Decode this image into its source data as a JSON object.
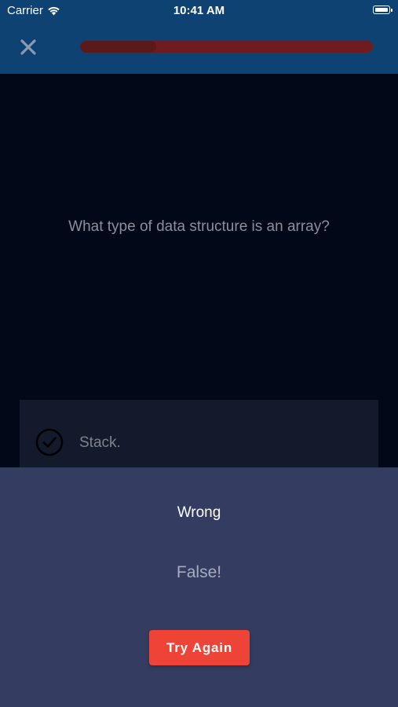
{
  "status_bar": {
    "carrier": "Carrier",
    "time": "10:41 AM",
    "icons": [
      "wifi-icon",
      "battery-icon"
    ]
  },
  "header": {
    "close_icon": "close-icon",
    "progress": 0.26,
    "colors": {
      "background": "#0e4273",
      "progress_track": "#6e1c1f",
      "progress_fill": "#5a1a1a"
    }
  },
  "question": {
    "text": "What type of data structure is an array?"
  },
  "answers": [
    {
      "label": "Stack.",
      "icon": "check-circle-icon"
    }
  ],
  "result": {
    "title": "Wrong",
    "message": "False!",
    "button_label": "Try Again",
    "colors": {
      "sheet": "#343c62",
      "button": "#ee4438"
    }
  }
}
